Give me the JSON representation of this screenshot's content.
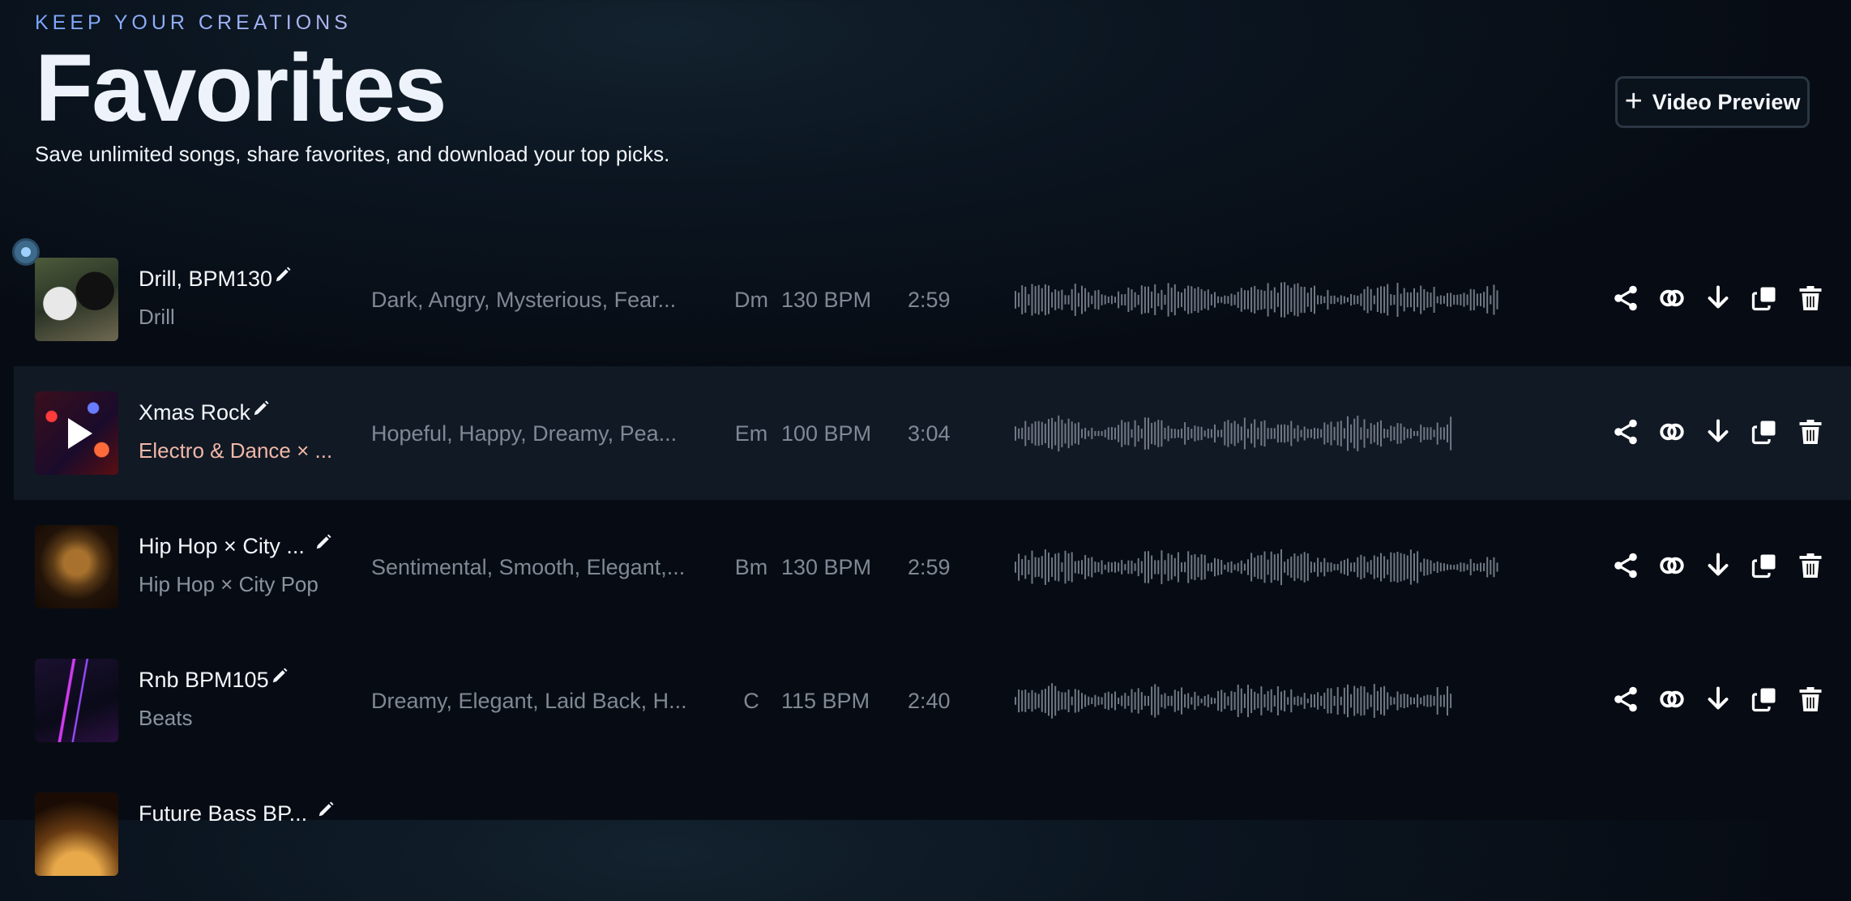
{
  "header": {
    "eyebrow": "KEEP YOUR CREATIONS",
    "title": "Favorites",
    "subtitle": "Save unlimited songs, share favorites, and download your top picks."
  },
  "video_preview": {
    "label": "Video Preview",
    "icon": "plus-icon"
  },
  "songs": [
    {
      "title": "Drill, BPM130",
      "genre": "Drill",
      "moods": "Dark, Angry, Mysterious, Fear...",
      "key": "Dm",
      "bpm": "130 BPM",
      "duration": "2:59",
      "active": false,
      "playing": false
    },
    {
      "title": "Xmas Rock",
      "genre": "Electro & Dance × ...",
      "moods": "Hopeful, Happy, Dreamy, Pea...",
      "key": "Em",
      "bpm": "100 BPM",
      "duration": "3:04",
      "active": true,
      "playing": true
    },
    {
      "title": "Hip Hop × City ...",
      "genre": "Hip Hop × City Pop",
      "moods": "Sentimental, Smooth, Elegant,...",
      "key": "Bm",
      "bpm": "130 BPM",
      "duration": "2:59",
      "active": false,
      "playing": false
    },
    {
      "title": "Rnb BPM105",
      "genre": "Beats",
      "moods": "Dreamy, Elegant, Laid Back, H...",
      "key": "C",
      "bpm": "115 BPM",
      "duration": "2:40",
      "active": false,
      "playing": false
    },
    {
      "title": "Future Bass BP...",
      "genre": "",
      "moods": "",
      "key": "",
      "bpm": "",
      "duration": "",
      "active": false,
      "playing": false
    }
  ],
  "row_actions": [
    "share-icon",
    "link-icon",
    "download-icon",
    "duplicate-icon",
    "trash-icon"
  ],
  "colors": {
    "background": "#070c14",
    "active_row": "#111924",
    "accent_genre": "#f0b7a8"
  }
}
